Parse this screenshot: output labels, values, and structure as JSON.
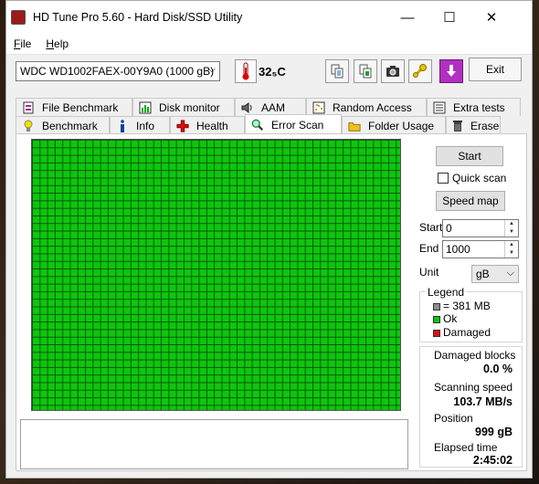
{
  "window": {
    "title": "HD Tune Pro 5.60 - Hard Disk/SSD Utility",
    "minimize": "—",
    "maximize": "☐",
    "close": "✕"
  },
  "menu": {
    "file_underline": "F",
    "file_rest": "ile",
    "help_underline": "H",
    "help_rest": "elp"
  },
  "toolbar": {
    "drive": "WDC WD1002FAEX-00Y9A0 (1000 gB)",
    "drive_caret": "⌵",
    "temperature": "32₅C",
    "exit": "Exit"
  },
  "tabs": {
    "top": [
      "File Benchmark",
      "Disk monitor",
      "AAM",
      "Random Access",
      "Extra tests"
    ],
    "bottom": [
      "Benchmark",
      "Info",
      "Health",
      "Error Scan",
      "Folder Usage",
      "Erase"
    ],
    "active": "Error Scan"
  },
  "scan": {
    "start_button": "Start",
    "quick_scan": "Quick scan",
    "quick_scan_checked": false,
    "speed_map_button": "Speed map",
    "start_label": "Start",
    "start_value": "0",
    "end_label": "End",
    "end_value": "1000",
    "unit_label": "Unit",
    "unit_value": "gB",
    "spin_up": "▲",
    "spin_down": "▼"
  },
  "legend": {
    "title": "Legend",
    "block_size": "= 381 MB",
    "ok": "Ok",
    "damaged": "Damaged",
    "colors": {
      "block": "#8c8c8c",
      "ok": "#0dc60d",
      "damaged": "#e01010"
    }
  },
  "stats": {
    "damaged_blocks_label": "Damaged blocks",
    "damaged_blocks_value": "0.0 %",
    "scanning_speed_label": "Scanning speed",
    "scanning_speed_value": "103.7 MB/s",
    "position_label": "Position",
    "position_value": "999 gB",
    "elapsed_label": "Elapsed time",
    "elapsed_value": "2:45:02"
  }
}
